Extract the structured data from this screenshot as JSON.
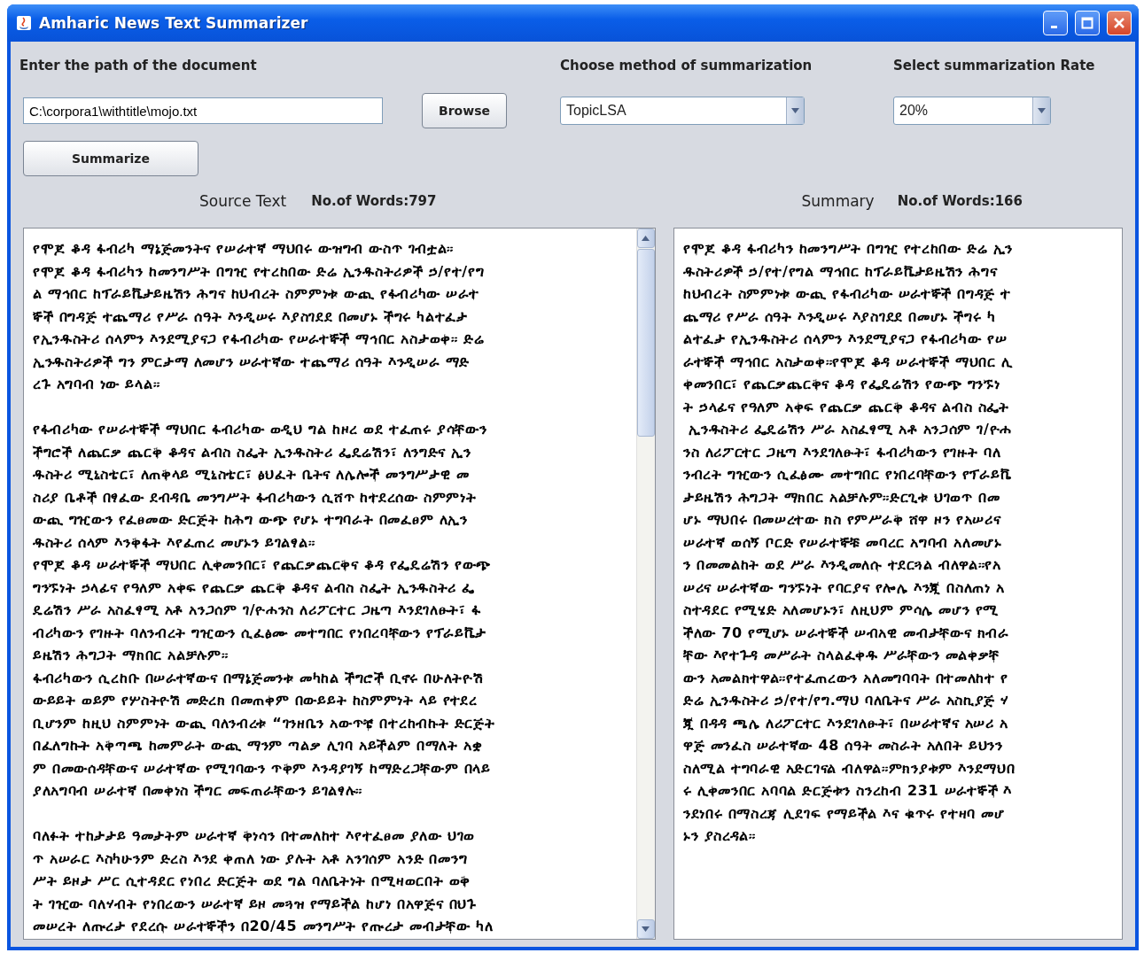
{
  "window": {
    "title": "Amharic News Text Summarizer"
  },
  "path": {
    "label": "Enter the path of the document",
    "value": "C:\\corpora1\\withtitle\\mojo.txt"
  },
  "browse_button": "Browse",
  "method": {
    "label": "Choose method of summarization",
    "value": "TopicLSA"
  },
  "rate": {
    "label": "Select summarization Rate",
    "value": "20%"
  },
  "summarize_button": "Summarize",
  "source": {
    "heading": "Source Text",
    "word_count": "No.of Words:797",
    "blocks": [
      [
        "የሞጆ ቆዳ ፋብሪካ ማኔጅመንትና የሠራተኛ ማህበሩ ውዝግብ ውስጥ ገብቷል።",
        "የሞጆ ቆዳ ፋብሪካን ከመንግሥት በግዢ የተረከበው ድሬ ኢንዱስትሪዎች ኃ/የተ/የግ",
        "ል ማኅበር ከፕራይቬታይዜሽን ሕግና ከህብረት ስምምነቱ ውጪ የፋብሪካው ሠራተ",
        "ኞች በግዳጅ ተጨማሪ የሥራ ሰዓት እንዲሠሩ እያስገደደ በመሆኑ ችግሩ ካልተፈታ",
        "የኢንዱስትሪ ሰላምን እንደሚያናጋ የፋብሪካው የሠራተኞች ማኅበር አስታወቀ። ድሬ",
        "ኢንዱስትሪዎች ግን ምርታማ ለመሆን ሠራተኛው ተጨማሪ ሰዓት እንዲሠራ ማድ",
        "ረጉ አግባብ ነው ይላል።"
      ],
      [
        "የፋብሪካው የሠራተኞች ማህበር ፋብሪካው ወዲህ ግል ከዞረ ወደ ተፈጠሩ ያሳቸውን",
        "ችግሮች ለጨርቃ ጨርቅ ቆዳና ልብስ ስፌት ኢንዱስትሪ ፌዴሬሽን፣ ለንግድና ኢን",
        "ዱስትሪ ሚኒስቴር፣ ለጠቅላይ ሚኒስቴር፣ ፅህፈት ቤትና ለሌሎች መንግሥታዊ መ",
        "ስሪያ ቤቶች በፃፈው ደብዳቤ መንግሥት ፋብሪካውን ሲሸጥ ከተደረሰው ስምምነት",
        "ውጪ ግዢውን የፈፀመው ድርጅት ከሕግ ውጭ የሆኑ ተግባራት በመፈፀም ለኢን",
        "ዱስትሪ ሰላም እንቅፋት እየፈጠረ መሆኑን ይገልፃል።",
        "የሞጆ ቆዳ ሠራተኞች ማህበር ሊቀመንበር፣ የጨርቃጨርቅና ቆዳ የፌዴሬሽን የውጭ",
        "ግንኙነት ኃላፊና የዓለም አቀፍ የጨርቃ ጨርቅ ቆዳና ልብስ ስፌት ኢንዱስትሪ ፌ",
        "ዴሬሽን ሥራ አስፈፃሚ አቶ አንጋሰም ገ/ዮሐንስ ለሪፖርተር ጋዜጣ እንደገለፁት፣ ፋ",
        "ብሪካውን የገዙት ባለንብረት ግዢውን ሲፈፅሙ መተግበር የነበረባቸውን የፕራይቬታ",
        "ይዜሽን ሕግጋት ማክበር አልቻሉም።",
        "ፋብሪካውን ሲረከቡ በሠራተኛውና በማኔጅመንቱ መካከል ችግሮች ቢኖሩ በሁለትዮሽ",
        "ውይይት ወይም የሦስትዮሽ መድረክ በመጠቀም በውይይት ከስምምነት ላይ የተደረ",
        "ቢሆንም ከዚህ ስምምነት ውጪ ባለንብረቱ “ገንዘቤን አውጥቼ በተረከብኩት ድርጅት",
        "በፈለግኩት አቅጣጫ ከመምራት ውጪ ማንም ጣልቃ ሊገባ አይችልም በማለት አቋ",
        "ም በመውሰዳቸውና ሠራተኛው የሚገባውን ጥቅም እንዳያገኝ ከማድረጋቸውም በላይ",
        "ያለአግባብ ሠራተኛ በመቀነስ ችግር መፍጠራቸውን ይገልፃሉ።"
      ],
      [
        "ባለፉት ተከታታይ ዓመታትም ሠራተኛ ቅነሳን በተመለከተ እየተፈፀመ ያለው ህገወ",
        "ጥ አሠራር እስካሁንም ድረስ እንደ ቀጠለ ነው ያሉት አቶ አንገሰም አንድ በመንግ",
        "ሥት ይዞታ ሥር ሲተዳደር የነበረ ድርጅት ወደ ግል ባለቤትነት በሚዛወርበት ወቅ",
        "ት ገዢው ባለሃብት የነበረውን ሠራተኛ ይዞ መጓዝ የማይችል ከሆነ በአዋጅና በህጉ",
        "መሠረት ለጡረታ የደረሱ ሠራተኞችን በ20/45 መንግሥት የጡረታ መብታቸው ካለ"
      ]
    ]
  },
  "summary": {
    "heading": "Summary",
    "word_count": "No.of Words:166",
    "blocks": [
      [
        "የሞጆ ቆዳ ፋብሪካን ከመንግሥት በግዢ የተረከበው ድሬ ኢን",
        "ዱስትሪዎች ኃ/የተ/የግል ማኅበር ከፕራይቬታይዜሽን ሕግና",
        "ከህብረት ስምምነቱ ውጪ የፋብሪካው ሠራተኞች በግዳጅ ተ",
        "ጨማሪ የሥራ ሰዓት እንዲሠሩ እያስገደደ በመሆኑ ችግሩ ካ",
        "ልተፈታ የኢንዱስትሪ ሰላምን እንደሚያናጋ የፋብሪካው የሠ",
        "ራተኞች ማኅበር አስታወቀ።የሞጆ ቆዳ ሠራተኞች ማህበር ሊ",
        "ቀመንበር፣ የጨርቃጨርቅና ቆዳ የፌዴሬሽን የውጭ ግንኙነ",
        "ት ኃላፊና የዓለም አቀፍ የጨርቃ ጨርቅ ቆዳና ልብስ ስፌት",
        " ኢንዱስትሪ ፌዴሬሽን ሥራ አስፈፃሚ አቶ አንጋሰም ገ/ዮሐ",
        "ንስ ለሪፖርተር ጋዜጣ እንደገለፁት፣ ፋብሪካውን የገዙት ባለ",
        "ንብረት ግዢውን ሲፈፅሙ መተግበር የነበረባቸውን የፕራይቬ",
        "ታይዜሽን ሕግጋት ማክበር አልቻሉም።ድርጊቱ ህገወጥ በመ",
        "ሆኑ ማህበሩ በመሠረተው ክስ የምሥራቅ ሸዋ ዞን የአሠሪና",
        "ሠራተኛ ወሰኝ ቦርድ የሠራተኞቹ መባረር አግባብ አለመሆኑ",
        "ን በመመልከት ወደ ሥራ እንዲመለሱ ተደርጓል ብለዋል።የአ",
        "ሠሪና ሠራተኛው ግንኙነት የባርያና የሎሌ እንጂ በስለጠነ አ",
        "ስተዳደር የሚሄድ አለመሆኑን፣ ለዚህም ምሳሌ መሆን የሚ",
        "ችለው 70 የሚሆኑ ሠራተኞች ሠብአዊ መብታቸውና ክብራ",
        "ቸው እየተጉዳ መሥራት ስላልፈቀዱ ሥራቸውን መልቀቃቸ",
        "ውን አመልክተዋል።የተፈጠረውን አለመግባባት በተመለከተ የ",
        "ድሬ ኢንዱስትሪ ኃ/የተ/የግ.ማህ ባለቤትና ሥራ አስኪያጅ ሃ",
        "ጂ በዳዳ ጫሌ ለሪፖርተር እንደገለፁት፣ በሠራተኛና አሠሪ አ",
        "ዋጅ መንፈስ ሠራተኛው 48 ሰዓት መስራት አለበት ይህንን",
        "ስለሚል ተግባራዊ አድርገናል ብለዋል።ምክንያቱም እንደማህበ",
        "ሩ ሊቀመንበር አባባል ድርጅቱን ስንረከብ 231 ሠራተኞች እ",
        "ንደነበሩ በማስረጃ ሊደገፍ የማይችል እና ቁጥሩ የተዛባ መሆ",
        "ኑን ያስረዳል።"
      ]
    ]
  }
}
